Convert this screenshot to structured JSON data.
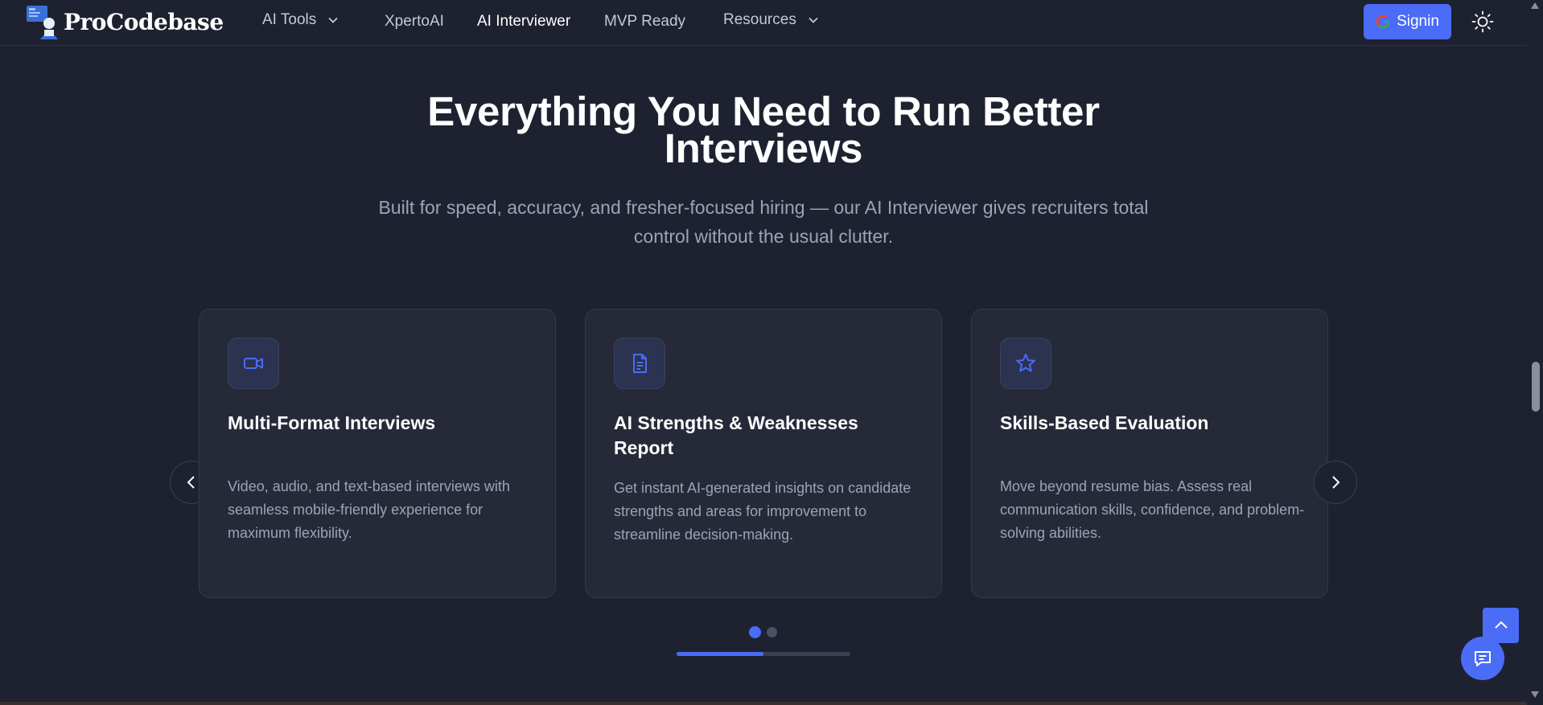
{
  "header": {
    "brand": "ProCodebase",
    "nav": [
      {
        "label": "AI Tools"
      },
      {
        "label": "XpertoAI"
      },
      {
        "label": "AI Interviewer"
      },
      {
        "label": "MVP Ready"
      },
      {
        "label": "Resources"
      }
    ],
    "signin_label": "Signin"
  },
  "hero": {
    "title": "Everything You Need to Run Better Interviews",
    "subtitle": "Built for speed, accuracy, and fresher-focused hiring — our AI Interviewer gives recruiters total control without the usual clutter."
  },
  "cards": [
    {
      "title": "Multi-Format Interviews",
      "description": "Video, audio, and text-based interviews with seamless mobile-friendly experience for maximum flexibility.",
      "icon": "video-icon"
    },
    {
      "title": "AI Strengths & Weaknesses Report",
      "description": "Get instant AI-generated insights on candidate strengths and areas for improvement to streamline decision-making.",
      "icon": "document-icon"
    },
    {
      "title": "Skills-Based Evaluation",
      "description": "Move beyond resume bias. Assess real communication skills, confidence, and problem-solving abilities.",
      "icon": "star-icon"
    }
  ],
  "carousel": {
    "active_dot": 0,
    "dot_count": 2,
    "progress": 0.5
  },
  "colors": {
    "background": "#1e2230",
    "accent": "#4a6cf7",
    "card": "#262a38",
    "muted_text": "#9aa3b8"
  }
}
